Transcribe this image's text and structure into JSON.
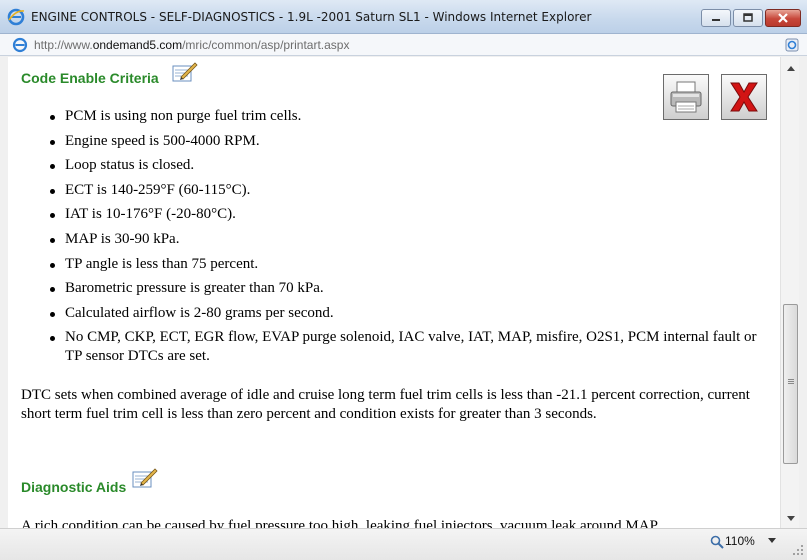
{
  "window": {
    "title": "ENGINE CONTROLS - SELF-DIAGNOSTICS - 1.9L -2001 Saturn SL1 - Windows Internet Explorer",
    "icon": "ie-icon",
    "controls": [
      "minimize-icon",
      "maximize-icon",
      "close-icon"
    ]
  },
  "address": {
    "prefix": "http://www.",
    "domain": "ondemand5.com",
    "path": "/mric/common/asp/printart.aspx"
  },
  "content": {
    "heading1": "Code Enable Criteria",
    "criteria": [
      "PCM is using non purge fuel trim cells.",
      "Engine speed is 500-4000 RPM.",
      "Loop status is closed.",
      "ECT is 140-259°F (60-115°C).",
      "IAT is 10-176°F (-20-80°C).",
      "MAP is 30-90 kPa.",
      "TP angle is less than 75 percent.",
      "Barometric pressure is greater than 70 kPa.",
      "Calculated airflow is 2-80 grams per second.",
      "No CMP, CKP, ECT, EGR flow, EVAP purge solenoid, IAC valve, IAT, MAP, misfire, O2S1, PCM internal fault or TP sensor DTCs are set."
    ],
    "dtc_paragraph": "DTC sets when combined average of idle and cruise long term fuel trim cells is less than -21.1 percent correction, current short term fuel trim cell is less than zero percent and condition exists for greater than 3 seconds.",
    "heading2": "Diagnostic Aids",
    "cutoff_text": "A rich condition can be caused by fuel pressure too high, leaking fuel injectors, vacuum leak around MAP"
  },
  "status": {
    "zoom": "110%"
  },
  "colors": {
    "heading": "#2a8a2a",
    "close_x": "#d21414"
  }
}
